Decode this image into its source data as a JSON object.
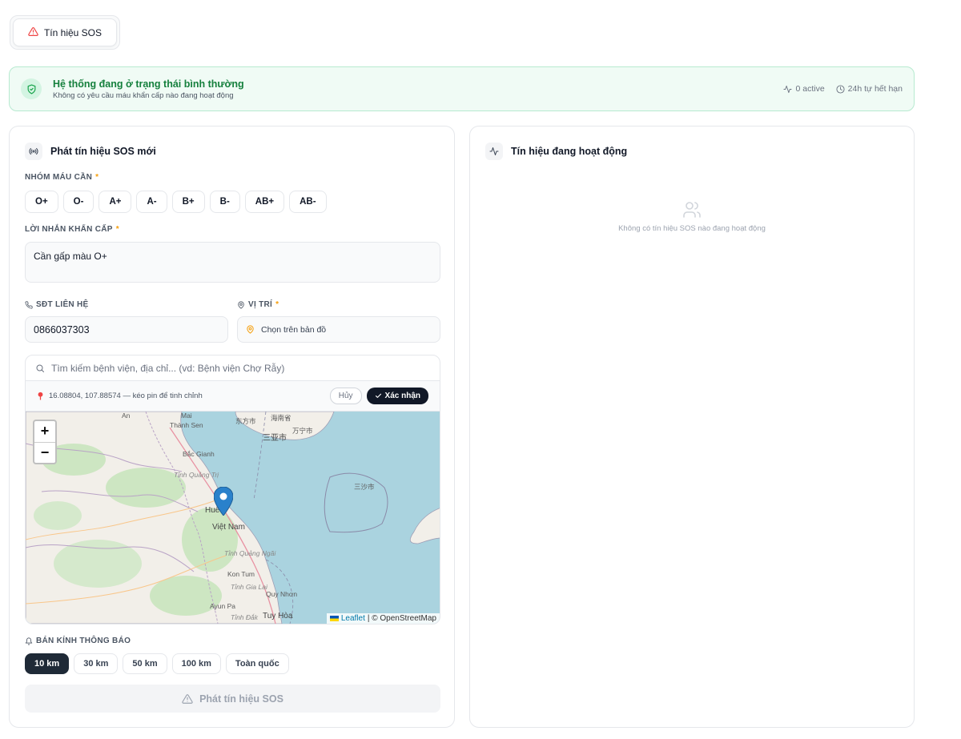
{
  "tabs": {
    "sos_label": "Tín hiệu SOS"
  },
  "status": {
    "title": "Hệ thống đang ở trạng thái bình thường",
    "subtitle": "Không có yêu cầu máu khẩn cấp nào đang hoạt động",
    "active_text": "0 active",
    "expiry_text": "24h tự hết hạn"
  },
  "form": {
    "title": "Phát tín hiệu SOS mới",
    "blood_label": "NHÓM MÁU CẦN",
    "required_mark": "*",
    "blood_types": [
      "O+",
      "O-",
      "A+",
      "A-",
      "B+",
      "B-",
      "AB+",
      "AB-"
    ],
    "message_label": "LỜI NHẮN KHẨN CẤP",
    "message_value": "Cần gấp màu O+",
    "phone_label": "SĐT LIÊN HỆ",
    "phone_value": "0866037303",
    "location_label": "VỊ TRÍ",
    "location_button": "Chọn trên bản đồ",
    "map": {
      "search_placeholder": "Tìm kiếm bệnh viện, địa chỉ... (vd: Bệnh viện Chợ Rẫy)",
      "coord_text": "16.08804, 107.88574 — kéo pin để tinh chỉnh",
      "cancel_label": "Hủy",
      "confirm_label": "Xác nhận",
      "zoom_in": "+",
      "zoom_out": "−",
      "attribution_leaflet": "Leaflet",
      "attribution_osm": "| © OpenStreetMap",
      "labels": {
        "thanh_sen": "Thành Sen",
        "bac_giang": "Bắc Gianh",
        "hue": "Huế",
        "viet_nam": "Việt Nam",
        "kon_tum": "Kon Tum",
        "quy_nhon": "Quy Nhơn",
        "tuy_hoa": "Tuy Hòa",
        "ayun_pa": "Ayun Pa",
        "tinh_quang_tri": "Tỉnh Quảng Trị",
        "tinh_quang_ngai": "Tỉnh Quảng Ngãi",
        "tinh_gia_lai": "Tỉnh Gia Lai",
        "tinh_dak": "Tỉnh Đắk",
        "dong_fang": "东方市",
        "hai_nan": "海南省",
        "san_ya": "三亚市",
        "wan_ning": "万宁市",
        "san_sha": "三沙市",
        "mai": "Mai",
        "an": "An"
      }
    },
    "radius_label": "BÁN KÍNH THÔNG BÁO",
    "radius_options": [
      "10 km",
      "30 km",
      "50 km",
      "100 km",
      "Toàn quốc"
    ],
    "submit_label": "Phát tín hiệu SOS"
  },
  "active_panel": {
    "title": "Tín hiệu đang hoạt động",
    "empty_text": "Không có tín hiệu SOS nào đang hoạt động"
  },
  "colors": {
    "accent_dark": "#1f2a37",
    "success_green": "#15803d",
    "warning_amber": "#f59e0b",
    "sos_red": "#ef4444",
    "pin_blue": "#2a81cb",
    "sea": "#aad3df"
  }
}
